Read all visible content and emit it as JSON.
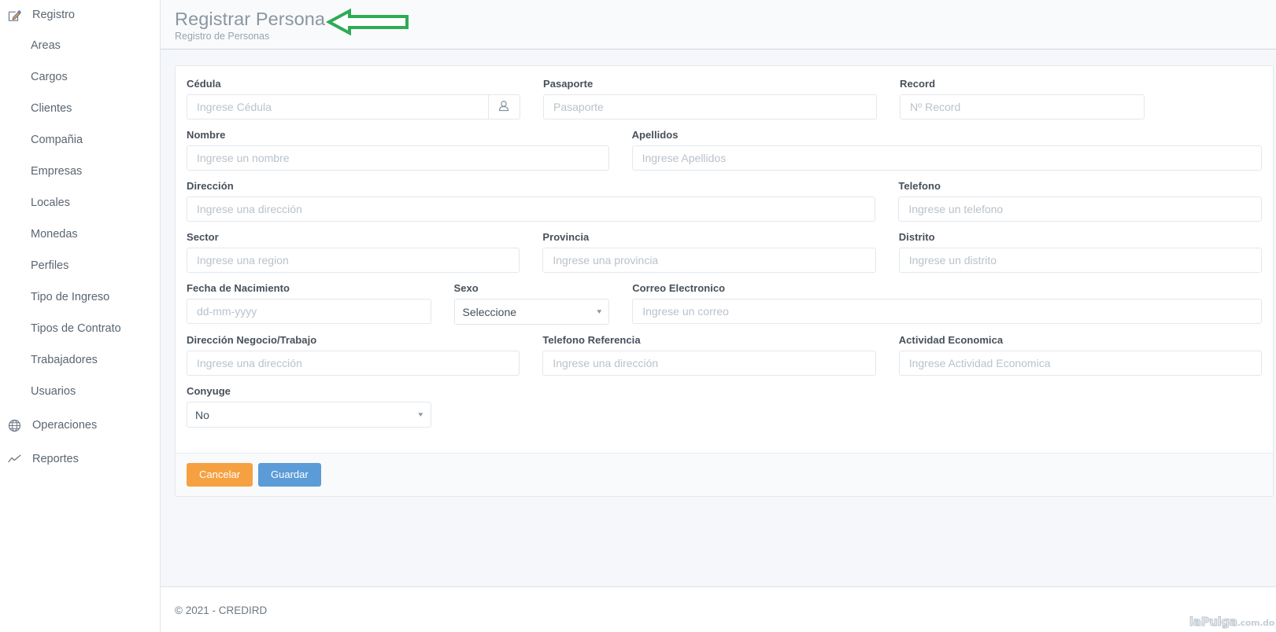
{
  "sidebar": {
    "groups": [
      {
        "icon": "edit-pencil-square-icon",
        "label": "Registro",
        "items": [
          {
            "label": "Areas"
          },
          {
            "label": "Cargos"
          },
          {
            "label": "Clientes"
          },
          {
            "label": "Compañia"
          },
          {
            "label": "Empresas"
          },
          {
            "label": "Locales"
          },
          {
            "label": "Monedas"
          },
          {
            "label": "Perfiles"
          },
          {
            "label": "Tipo de Ingreso"
          },
          {
            "label": "Tipos de Contrato"
          },
          {
            "label": "Trabajadores"
          },
          {
            "label": "Usuarios"
          }
        ]
      },
      {
        "icon": "globe-icon",
        "label": "Operaciones",
        "items": []
      },
      {
        "icon": "line-chart-icon",
        "label": "Reportes",
        "items": []
      }
    ]
  },
  "header": {
    "title": "Registrar Persona",
    "subtitle": "Registro de Personas",
    "annotation": {
      "type": "left-arrow",
      "color": "#2eab55"
    }
  },
  "form": {
    "fields": {
      "cedula": {
        "label": "Cédula",
        "placeholder": "Ingrese Cédula",
        "value": "",
        "addon_icon": "person-lookup-icon"
      },
      "pasaporte": {
        "label": "Pasaporte",
        "placeholder": "Pasaporte",
        "value": ""
      },
      "record": {
        "label": "Record",
        "placeholder": "Nº Record",
        "value": ""
      },
      "nombre": {
        "label": "Nombre",
        "placeholder": "Ingrese un nombre",
        "value": ""
      },
      "apellidos": {
        "label": "Apellidos",
        "placeholder": "Ingrese Apellidos",
        "value": ""
      },
      "direccion": {
        "label": "Dirección",
        "placeholder": "Ingrese una dirección",
        "value": ""
      },
      "telefono": {
        "label": "Telefono",
        "placeholder": "Ingrese un telefono",
        "value": ""
      },
      "sector": {
        "label": "Sector",
        "placeholder": "Ingrese una region",
        "value": ""
      },
      "provincia": {
        "label": "Provincia",
        "placeholder": "Ingrese una provincia",
        "value": ""
      },
      "distrito": {
        "label": "Distrito",
        "placeholder": "Ingrese un distrito",
        "value": ""
      },
      "fecha_nacimiento": {
        "label": "Fecha de Nacimiento",
        "placeholder": "dd-mm-yyyy",
        "value": ""
      },
      "sexo": {
        "label": "Sexo",
        "selected": "Seleccione",
        "options": [
          "Seleccione"
        ]
      },
      "correo": {
        "label": "Correo Electronico",
        "placeholder": "Ingrese un correo",
        "value": ""
      },
      "direccion_negocio": {
        "label": "Dirección Negocio/Trabajo",
        "placeholder": "Ingrese una dirección",
        "value": ""
      },
      "telefono_referencia": {
        "label": "Telefono Referencia",
        "placeholder": "Ingrese una dirección",
        "value": ""
      },
      "actividad_economica": {
        "label": "Actividad Economica",
        "placeholder": "Ingrese Actividad Economica",
        "value": ""
      },
      "conyuge": {
        "label": "Conyuge",
        "selected": "No",
        "options": [
          "No"
        ]
      }
    },
    "buttons": {
      "cancel": {
        "label": "Cancelar",
        "color": "#f5a142"
      },
      "save": {
        "label": "Guardar",
        "color": "#5b9bd8"
      }
    }
  },
  "footer": {
    "copyright": "© 2021 - CREDIRD",
    "watermark_big": "laPulga",
    "watermark_small": ".com.do"
  }
}
